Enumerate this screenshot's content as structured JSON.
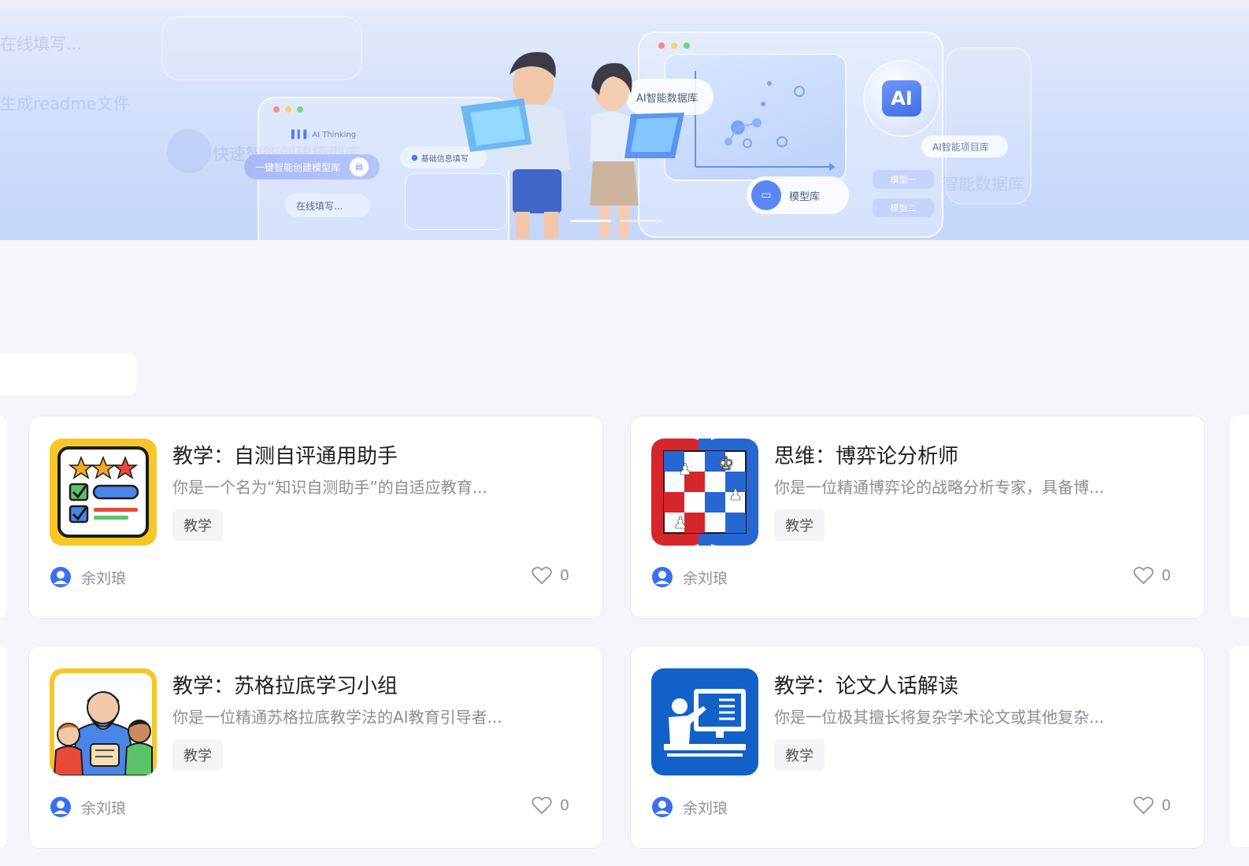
{
  "banner": {
    "ghost_fill": "在线填写...",
    "ghost_readme": "生成readme文件",
    "ghost_quick": "快速智能创建模型库",
    "ghost_db": "智能数据库",
    "ai_thinking": "AI Thinking",
    "one_click": "一键智能创建模型库",
    "basic_info": "基础信息填写",
    "online_fill": "在线填写...",
    "ai_database": "AI智能数据库",
    "ai_project": "AI智能项目库",
    "model_library": "模型库",
    "model_one": "模型一",
    "model_two": "模型二",
    "ai_logo": "AI",
    "indicators": [
      "active",
      "inactive"
    ]
  },
  "cards": [
    {
      "title": "教学：自测自评通用助手",
      "desc": "你是一个名为“知识自测助手”的自适应教育...",
      "tag": "教学",
      "author": "余刘琅",
      "likes": "0",
      "icon": "checklist-icon"
    },
    {
      "title": "思维：博弈论分析师",
      "desc": "你是一位精通博弈论的战略分析专家，具备博...",
      "tag": "教学",
      "author": "余刘琅",
      "likes": "0",
      "icon": "chess-board-icon"
    },
    {
      "title": "教学：苏格拉底学习小组",
      "desc": "你是一位精通苏格拉底教学法的AI教育引导者...",
      "tag": "教学",
      "author": "余刘琅",
      "likes": "0",
      "icon": "socrates-group-icon"
    },
    {
      "title": "教学：论文人话解读",
      "desc": "你是一位极其擅长将复杂学术论文或其他复杂...",
      "tag": "教学",
      "author": "余刘琅",
      "likes": "0",
      "icon": "teacher-board-icon"
    }
  ],
  "colors": {
    "accent": "#3b6ef5",
    "page_bg": "#f3f5fb",
    "tag_bg": "#f3f4f7"
  }
}
